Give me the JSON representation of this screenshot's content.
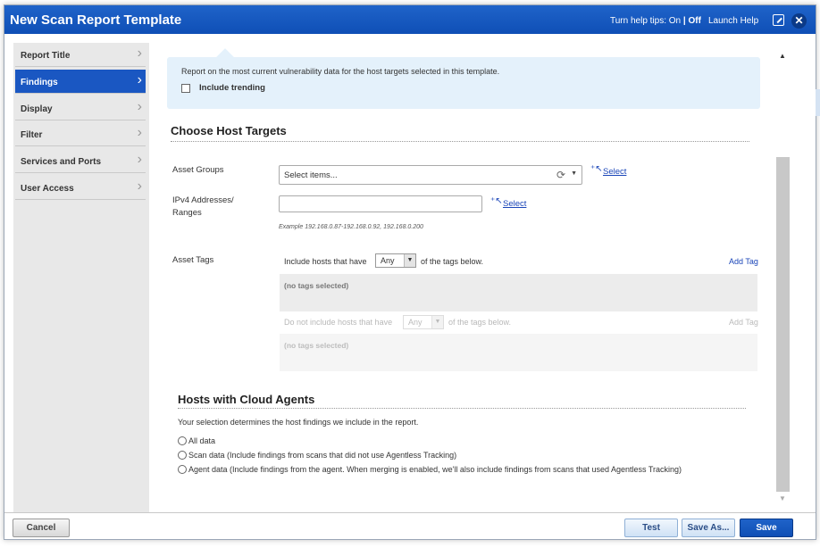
{
  "window": {
    "title": "New Scan Report Template",
    "help_tips_prefix": "Turn help tips:",
    "help_on": "On",
    "help_sep": "|",
    "help_off": "Off",
    "launch_help": "Launch Help",
    "popout_icon": "popout-icon",
    "close_icon": "close-icon"
  },
  "sidebar": {
    "items": [
      {
        "label": "Report Title",
        "active": false
      },
      {
        "label": "Findings",
        "active": true
      },
      {
        "label": "Display",
        "active": false
      },
      {
        "label": "Filter",
        "active": false
      },
      {
        "label": "Services and Ports",
        "active": false
      },
      {
        "label": "User Access",
        "active": false
      }
    ],
    "chevron": "›"
  },
  "info": {
    "description": "Report on the most current vulnerability data for the host targets selected in this template.",
    "include_trending_label": "Include trending",
    "include_trending_checked": false
  },
  "host_targets": {
    "heading": "Choose Host Targets",
    "asset_groups_label": "Asset Groups",
    "asset_groups_placeholder": "Select items...",
    "asset_groups_select_link": "Select",
    "ipv4_label_line1": "IPv4 Addresses/",
    "ipv4_label_line2": "Ranges",
    "ipv4_value": "",
    "ipv4_select_link": "Select",
    "example_prefix": "Example",
    "example_text": "192.168.0.87-192.168.0.92, 192.168.0.200",
    "asset_tags_label": "Asset Tags",
    "include_prefix": "Include hosts that have",
    "include_any": "Any",
    "include_suffix": "of the tags below.",
    "add_tag": "Add Tag",
    "no_tags": "(no tags selected)",
    "exclude_prefix": "Do not include hosts that have",
    "exclude_any": "Any",
    "exclude_suffix": "of the tags below.",
    "exclude_add_tag": "Add Tag",
    "exclude_no_tags": "(no tags selected)"
  },
  "cloud_agents": {
    "heading": "Hosts with Cloud Agents",
    "description": "Your selection determines the host findings we include in the report.",
    "options": [
      "All data",
      "Scan data (Include findings from scans that did not use Agentless Tracking)",
      "Agent data (Include findings from the agent. When merging is enabled, we'll also include findings from scans that used Agentless Tracking)"
    ],
    "selected_index": -1
  },
  "footer": {
    "cancel": "Cancel",
    "test": "Test",
    "save_as": "Save As...",
    "save": "Save"
  },
  "colors": {
    "title_bar": "#1a57c2",
    "active_nav": "#1a57c2",
    "info_bg": "#e4f1fb",
    "link": "#1a45b8"
  }
}
